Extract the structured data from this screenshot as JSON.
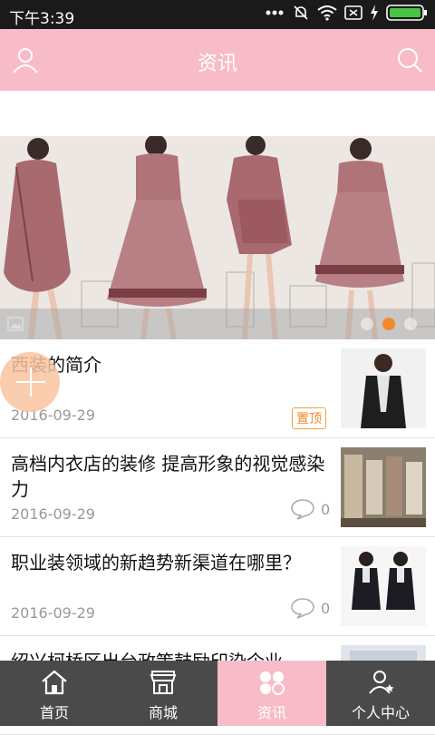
{
  "status_bar": {
    "time": "下午3:39"
  },
  "header": {
    "title": "资讯"
  },
  "banner": {
    "slide_count": 3,
    "active_slide": 1
  },
  "articles": [
    {
      "title": "西装的简介",
      "date": "2016-09-29",
      "badge": "置顶"
    },
    {
      "title": "高档内衣店的装修 提高形象的视觉感染力",
      "date": "2016-09-29",
      "comments": "0"
    },
    {
      "title": "职业装领域的新趋势新渠道在哪里？",
      "date": "2016-09-29",
      "comments": "0"
    },
    {
      "title": "绍兴柯桥区出台政策鼓励印染企业",
      "date": ""
    }
  ],
  "tabbar": [
    {
      "label": "首页",
      "icon": "home-icon"
    },
    {
      "label": "商城",
      "icon": "store-icon"
    },
    {
      "label": "资讯",
      "icon": "news-icon",
      "active": true
    },
    {
      "label": "个人中心",
      "icon": "user-center-icon"
    }
  ],
  "colors": {
    "accent": "#f8bcc8",
    "tabbar": "#4a4a4a",
    "badge": "#f08a2a"
  }
}
